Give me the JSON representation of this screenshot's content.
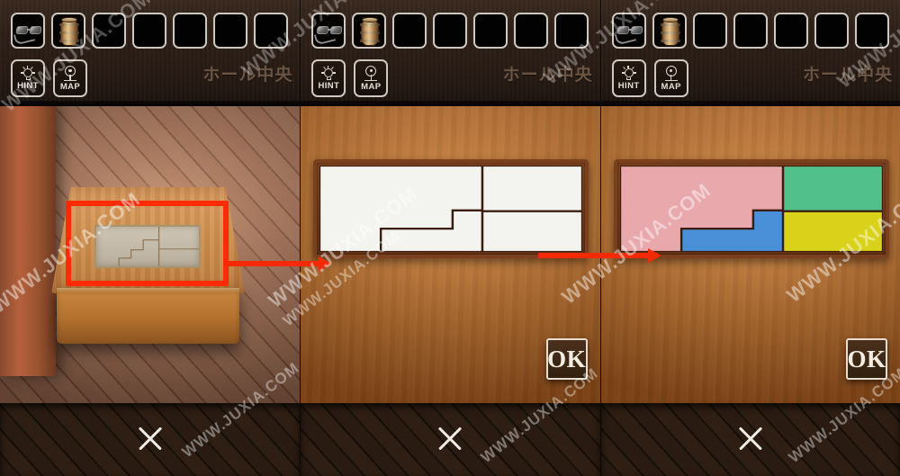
{
  "app": {
    "watermark": "WWW.JUXIA.COM",
    "colors": {
      "accent_red": "#f42a07",
      "wood": "#c87a33",
      "pink": "#e8a8ac",
      "blue": "#4a90d9",
      "green": "#52c08a",
      "yellow": "#d9d11a",
      "panel_top": "#2e2018"
    }
  },
  "hud": {
    "room_name": "ホール中央",
    "hint_label": "HINT",
    "map_label": "MAP",
    "slots": [
      {
        "name": "glasses",
        "filled": true
      },
      {
        "name": "barrel",
        "filled": true
      },
      {
        "name": "empty-3",
        "filled": false
      },
      {
        "name": "empty-4",
        "filled": false
      },
      {
        "name": "empty-5",
        "filled": false
      },
      {
        "name": "empty-6",
        "filled": false
      },
      {
        "name": "empty-7",
        "filled": false
      }
    ],
    "close_label": "✕"
  },
  "panels": [
    {
      "id": "panel-1",
      "type": "scene",
      "description": "wooden pedestal with stone puzzle tile on brick pavement",
      "highlight": "red-rectangle",
      "ok_label": ""
    },
    {
      "id": "panel-2",
      "type": "puzzle-uncolored",
      "description": "stone puzzle close-up, pieces uncolored",
      "ok_label": "OK"
    },
    {
      "id": "panel-3",
      "type": "puzzle-solved",
      "description": "puzzle solved with colored pieces",
      "ok_label": "OK"
    }
  ],
  "puzzle": {
    "pieces": [
      {
        "name": "pink-big-l",
        "color": "#e8a8ac"
      },
      {
        "name": "blue-staircase",
        "color": "#4a90d9"
      },
      {
        "name": "green-top",
        "color": "#52c08a"
      },
      {
        "name": "yellow-bottom",
        "color": "#d9d11a"
      }
    ],
    "uncolored_fill": "#f3f3f0",
    "line_color": "#3a1c0c"
  }
}
